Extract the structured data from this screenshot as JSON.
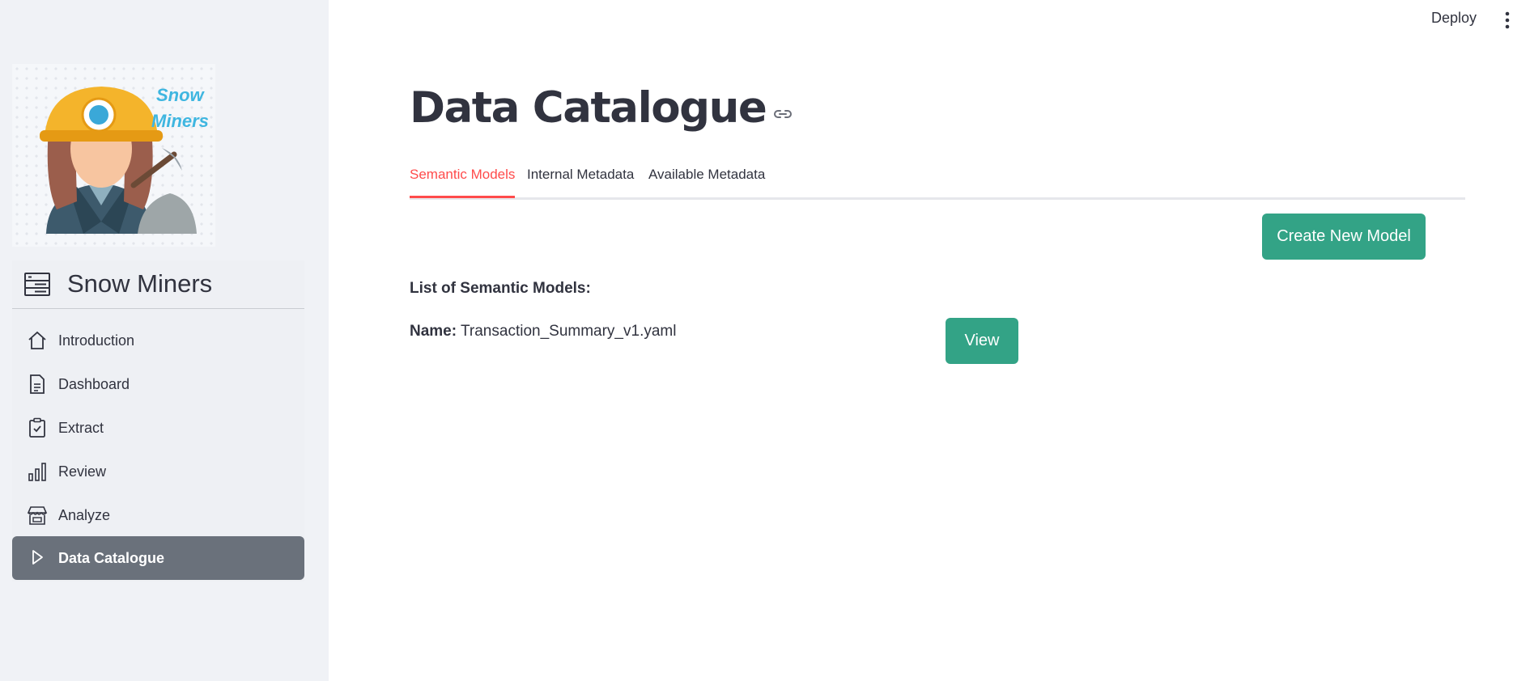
{
  "header": {
    "deploy_label": "Deploy",
    "menu_icon": "kebab-menu-icon"
  },
  "sidebar": {
    "logo": {
      "text_line1": "Snow",
      "text_line2": "Miners",
      "icon": "snow-miner-logo"
    },
    "brand": {
      "title": "Snow Miners",
      "icon": "server-stack-icon"
    },
    "items": [
      {
        "label": "Introduction",
        "icon": "house-icon",
        "active": false
      },
      {
        "label": "Dashboard",
        "icon": "document-icon",
        "active": false
      },
      {
        "label": "Extract",
        "icon": "clipboard-check-icon",
        "active": false
      },
      {
        "label": "Review",
        "icon": "bar-chart-icon",
        "active": false
      },
      {
        "label": "Analyze",
        "icon": "shop-icon",
        "active": false
      },
      {
        "label": "Data Catalogue",
        "icon": "play-icon",
        "active": true
      }
    ],
    "active_bg": "#6a717b"
  },
  "main": {
    "title": "Data Catalogue",
    "title_link_icon": "link-icon",
    "tabs": [
      {
        "label": "Semantic Models",
        "active": true
      },
      {
        "label": "Internal Metadata",
        "active": false
      },
      {
        "label": "Available Metadata",
        "active": false
      }
    ],
    "create_button_label": "Create New Model",
    "list_heading": "List of Semantic Models:",
    "models": [
      {
        "name_label": "Name:",
        "name": "Transaction_Summary_v1.yaml",
        "view_label": "View"
      }
    ]
  },
  "colors": {
    "accent": "#ff4b4b",
    "button": "#33a386",
    "sidebar_bg": "#f0f2f6",
    "text": "#31333f"
  }
}
